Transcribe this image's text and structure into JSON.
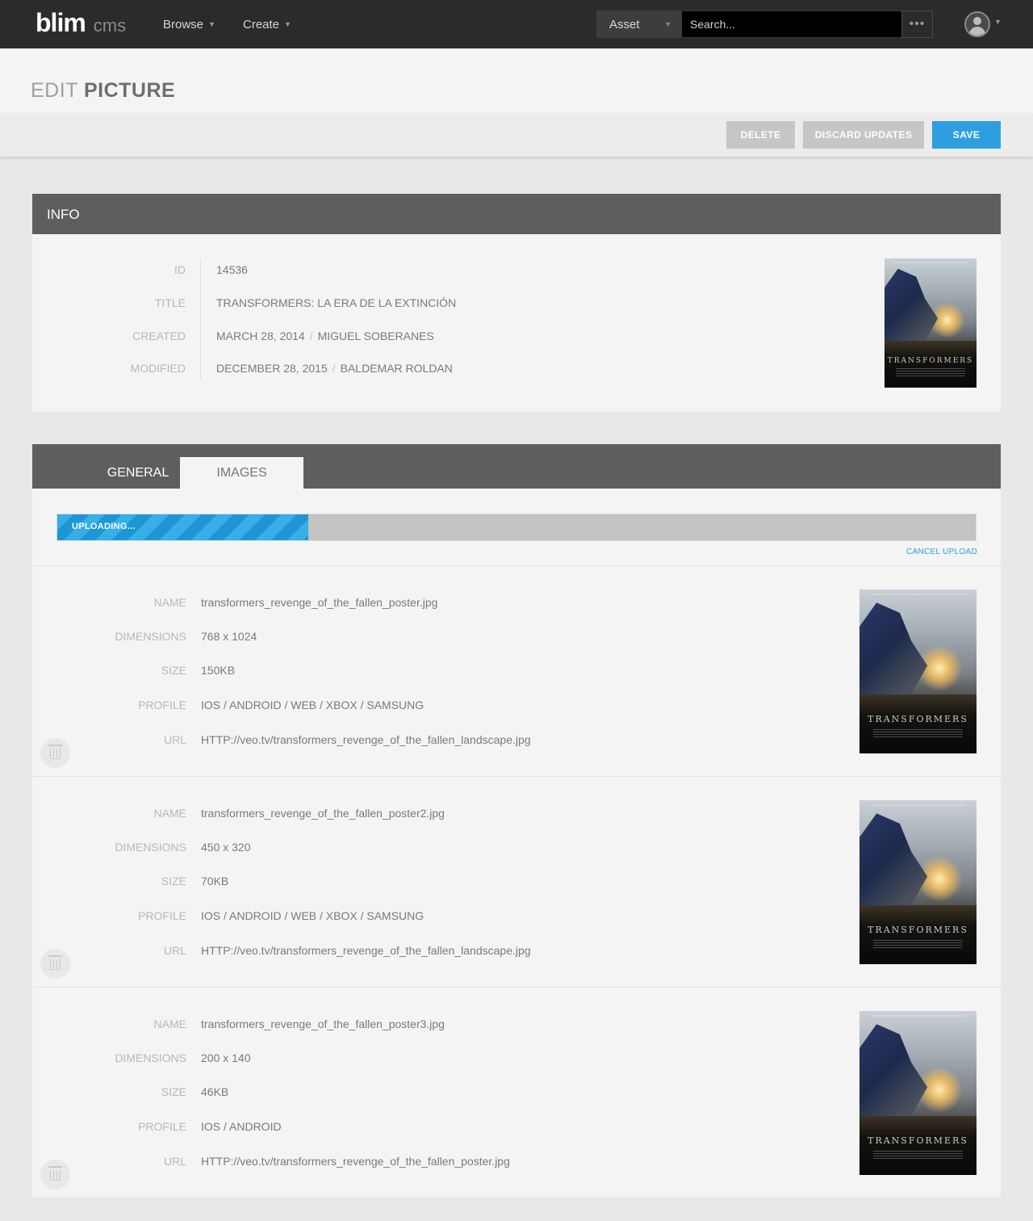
{
  "nav": {
    "brand": "blim",
    "brand_sub": "cms",
    "browse_label": "Browse",
    "create_label": "Create",
    "asset_select": "Asset",
    "search_placeholder": "Search...",
    "more_label": "•••"
  },
  "page": {
    "title_light": "EDIT",
    "title_bold": "PICTURE"
  },
  "actions": {
    "delete_label": "DELETE",
    "discard_label": "DISCARD UPDATES",
    "save_label": "SAVE"
  },
  "info": {
    "header": "INFO",
    "rows": [
      {
        "label": "ID",
        "value": "14536"
      },
      {
        "label": "TITLE",
        "value": "TRANSFORMERS: LA ERA DE LA EXTINCIÓN"
      },
      {
        "label": "CREATED",
        "value": "MARCH 28, 2014",
        "separator": "/",
        "value2": "MIGUEL SOBERANES"
      },
      {
        "label": "MODIFIED",
        "value": "DECEMBER 28, 2015",
        "separator": "/",
        "value2": "BALDEMAR ROLDAN"
      }
    ],
    "poster_logo": "TRANSFORMERS"
  },
  "tabs": [
    {
      "label": "GENERAL",
      "active": false
    },
    {
      "label": "IMAGES",
      "active": true
    }
  ],
  "upload": {
    "label": "UPLOADING...",
    "progress": 0.273,
    "cancel_label": "CANCEL UPLOAD"
  },
  "field_labels": {
    "name": "NAME",
    "dimensions": "DIMENSIONS",
    "size": "SIZE",
    "profile": "PROFILE",
    "url": "URL"
  },
  "images": [
    {
      "name": "transformers_revenge_of_the_fallen_poster.jpg",
      "dimensions": "768 x 1024",
      "size": "150KB",
      "profile": "IOS / ANDROID / WEB / XBOX / SAMSUNG",
      "url": "HTTP://veo.tv/transformers_revenge_of_the_fallen_landscape.jpg"
    },
    {
      "name": "transformers_revenge_of_the_fallen_poster2.jpg",
      "dimensions": "450 x 320",
      "size": "70KB",
      "profile": "IOS / ANDROID / WEB / XBOX / SAMSUNG",
      "url": "HTTP://veo.tv/transformers_revenge_of_the_fallen_landscape.jpg"
    },
    {
      "name": "transformers_revenge_of_the_fallen_poster3.jpg",
      "dimensions": "200 x 140",
      "size": "46KB",
      "profile": "IOS / ANDROID",
      "url": "HTTP://veo.tv/transformers_revenge_of_the_fallen_poster.jpg"
    }
  ],
  "colors": {
    "nav_bg": "#2b2b2b",
    "card_header": "#5e5e5e",
    "save_button": "#2e9ee0",
    "progress_fill": "#36aee6",
    "link": "#2c9fd9"
  }
}
